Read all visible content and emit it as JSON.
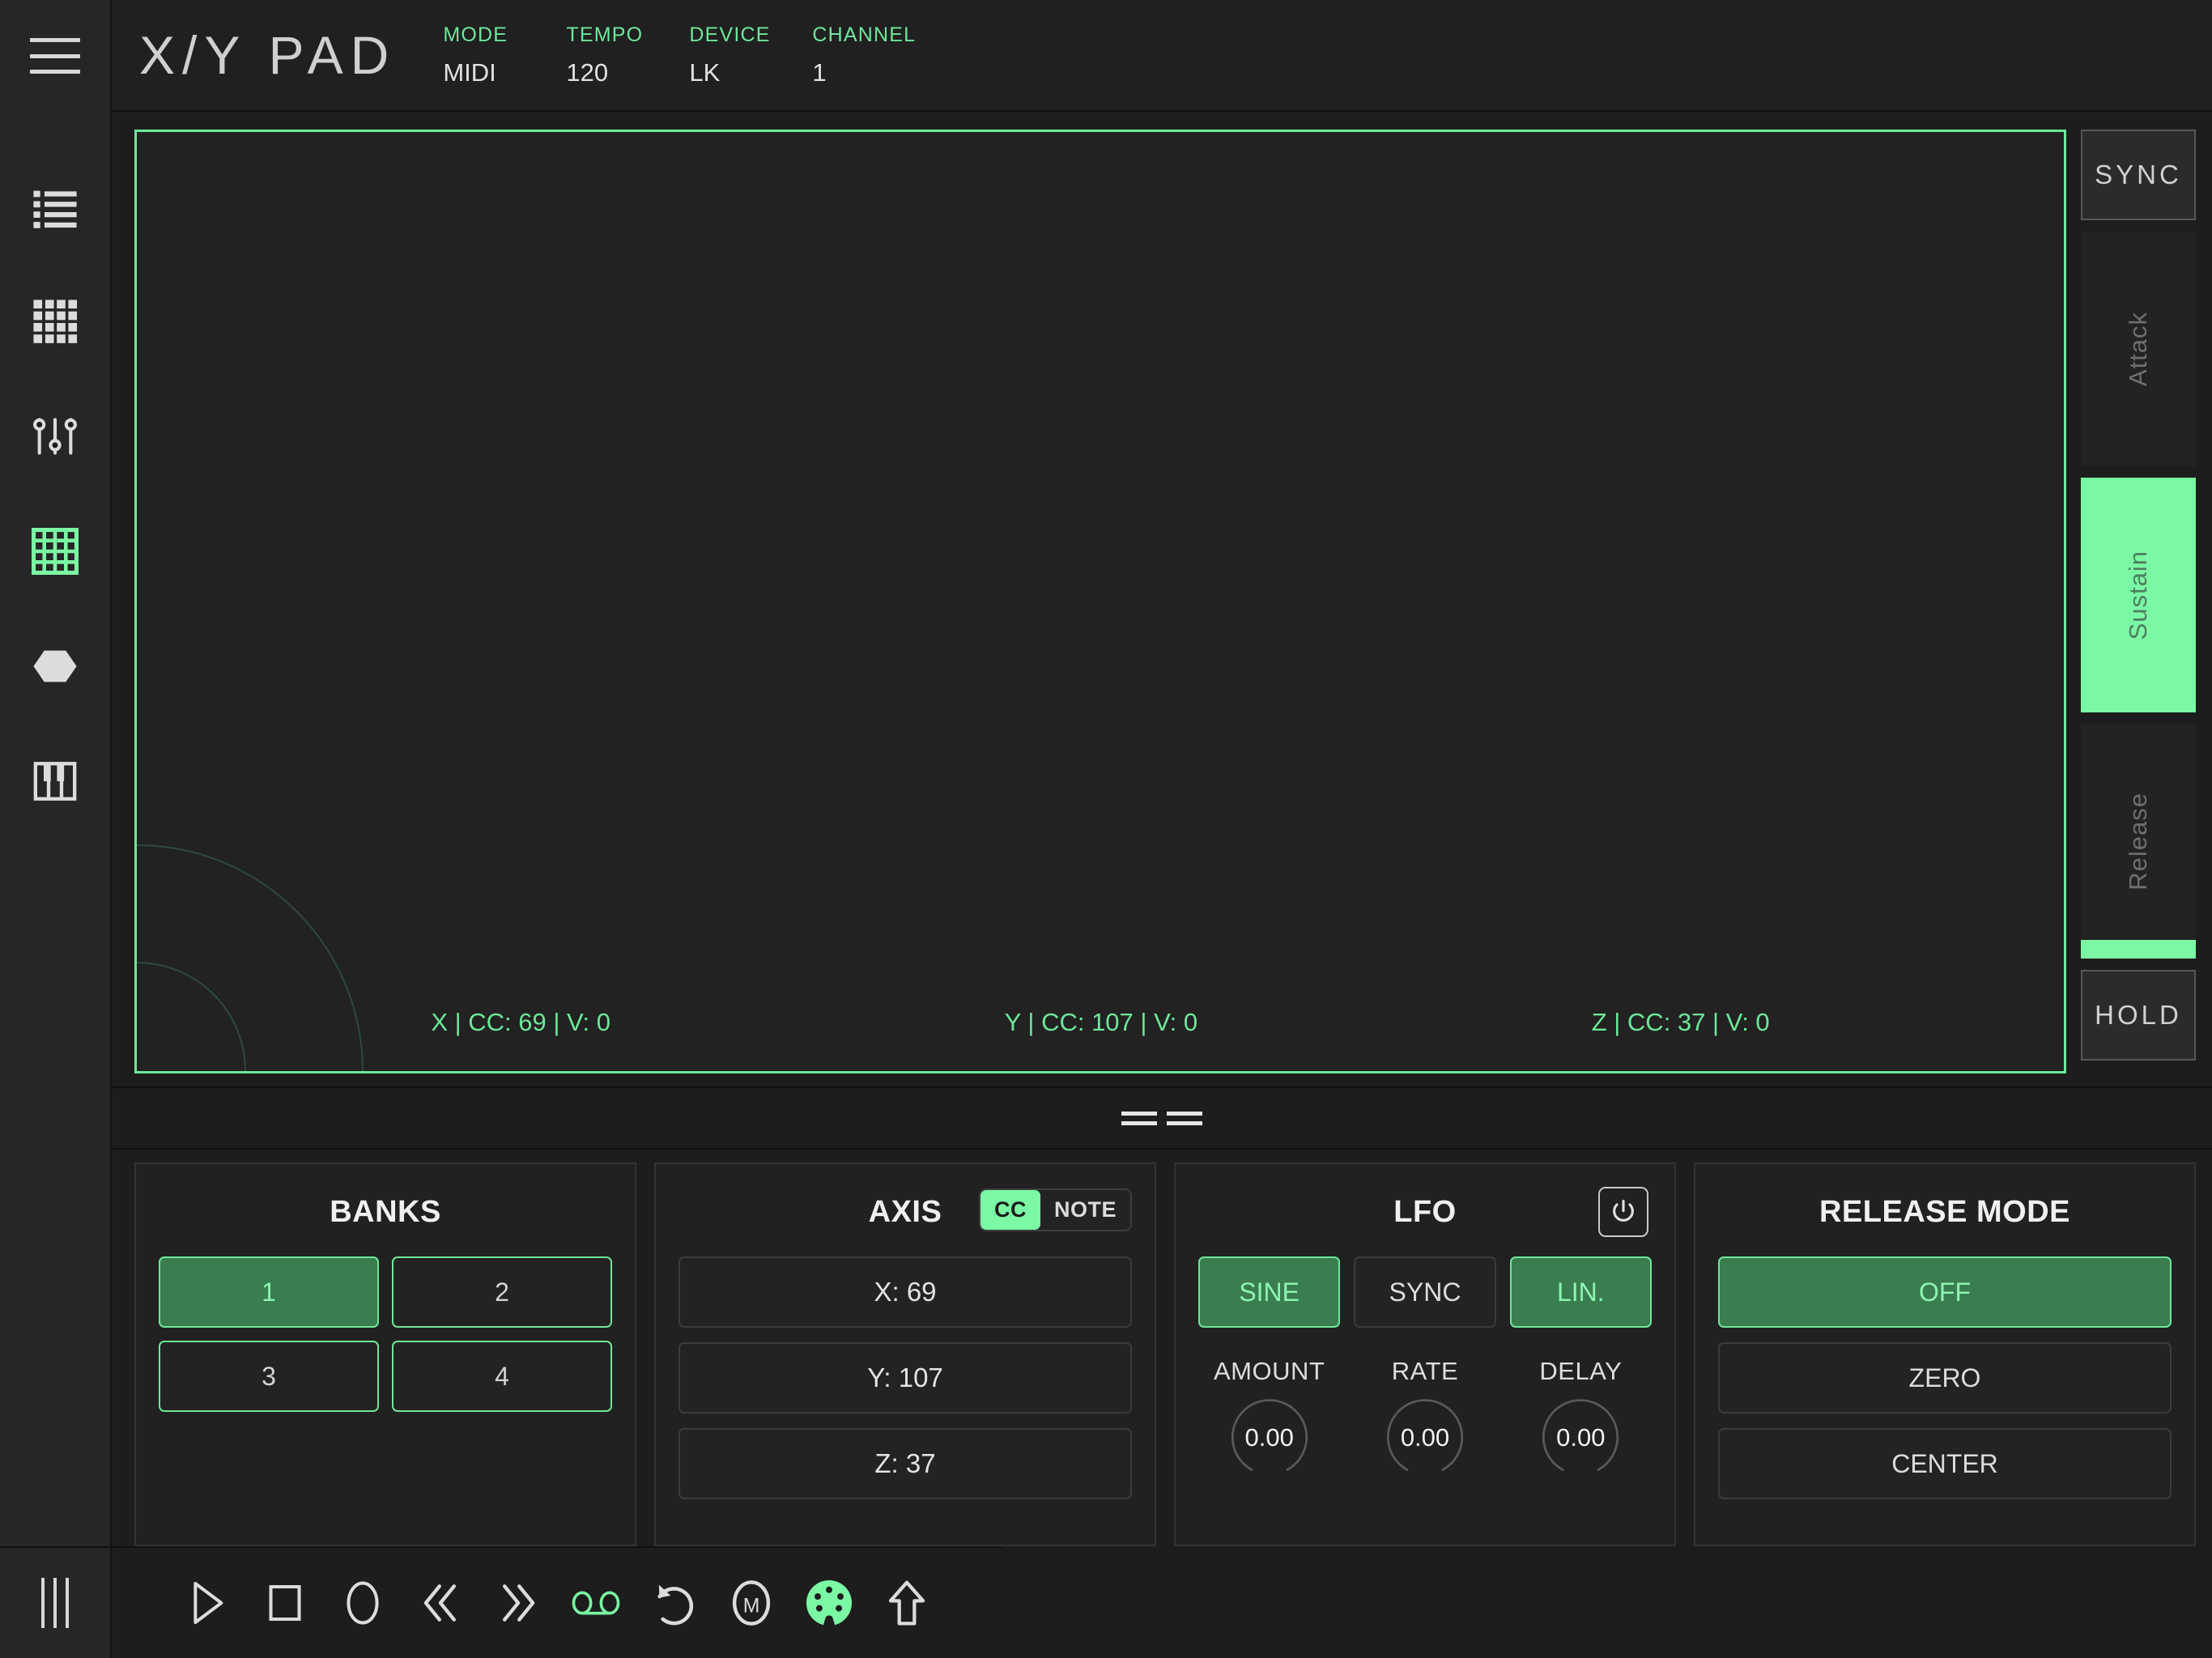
{
  "header": {
    "title": "X/Y PAD",
    "menu_icon": "hamburger-icon",
    "meta": [
      {
        "label": "MODE",
        "value": "MIDI"
      },
      {
        "label": "TEMPO",
        "value": "120"
      },
      {
        "label": "DEVICE",
        "value": "LK"
      },
      {
        "label": "CHANNEL",
        "value": "1"
      }
    ]
  },
  "sidebar": {
    "items": [
      {
        "name": "list-icon",
        "active": false
      },
      {
        "name": "pads-grid-icon",
        "active": false
      },
      {
        "name": "faders-icon",
        "active": false
      },
      {
        "name": "xy-grid-icon",
        "active": true
      },
      {
        "name": "hexagon-icon",
        "active": false
      },
      {
        "name": "piano-keys-icon",
        "active": false
      }
    ],
    "bottom_icon": "three-bars-icon"
  },
  "pad": {
    "readouts": [
      {
        "axis": "X",
        "text": "X | CC: 69 | V: 0"
      },
      {
        "axis": "Y",
        "text": "Y | CC: 107 | V: 0"
      },
      {
        "axis": "Z",
        "text": "Z | CC: 37 | V: 0"
      }
    ]
  },
  "rail": {
    "sync_label": "SYNC",
    "hold_label": "HOLD",
    "sliders": [
      {
        "label": "Attack",
        "fill_percent": 0
      },
      {
        "label": "Sustain",
        "fill_percent": 100
      },
      {
        "label": "Release",
        "fill_percent": 8
      }
    ]
  },
  "banks": {
    "title": "BANKS",
    "buttons": [
      {
        "label": "1",
        "active": true
      },
      {
        "label": "2",
        "active": false
      },
      {
        "label": "3",
        "active": false
      },
      {
        "label": "4",
        "active": false
      }
    ]
  },
  "axis": {
    "title": "AXIS",
    "toggle": {
      "cc": "CC",
      "note": "NOTE",
      "selected": "CC"
    },
    "rows": [
      {
        "label": "X: 69"
      },
      {
        "label": "Y: 107"
      },
      {
        "label": "Z: 37"
      }
    ]
  },
  "lfo": {
    "title": "LFO",
    "power_icon": "power-icon",
    "modes": [
      {
        "label": "SINE",
        "active": true
      },
      {
        "label": "SYNC",
        "active": false
      },
      {
        "label": "LIN.",
        "active": true
      }
    ],
    "knobs": [
      {
        "label": "AMOUNT",
        "value": "0.00"
      },
      {
        "label": "RATE",
        "value": "0.00"
      },
      {
        "label": "DELAY",
        "value": "0.00"
      }
    ]
  },
  "release_mode": {
    "title": "RELEASE MODE",
    "options": [
      {
        "label": "OFF",
        "active": true
      },
      {
        "label": "ZERO",
        "active": false
      },
      {
        "label": "CENTER",
        "active": false
      }
    ]
  },
  "transport": {
    "buttons": [
      {
        "name": "play-icon",
        "active": false
      },
      {
        "name": "stop-icon",
        "active": false
      },
      {
        "name": "record-icon",
        "active": false
      },
      {
        "name": "rewind-icon",
        "active": false
      },
      {
        "name": "fast-forward-icon",
        "active": false
      },
      {
        "name": "tape-loop-icon",
        "active": true
      },
      {
        "name": "undo-icon",
        "active": false
      },
      {
        "name": "metronome-icon",
        "active": false
      },
      {
        "name": "midi-din-icon",
        "active": true
      },
      {
        "name": "upload-icon",
        "active": false
      }
    ]
  },
  "colors": {
    "accent_bright": "#7bf8a3",
    "accent_outline": "#6ee79a",
    "accent_fill": "#3a7d50",
    "background": "#1d1d1d",
    "panel": "#212121"
  }
}
